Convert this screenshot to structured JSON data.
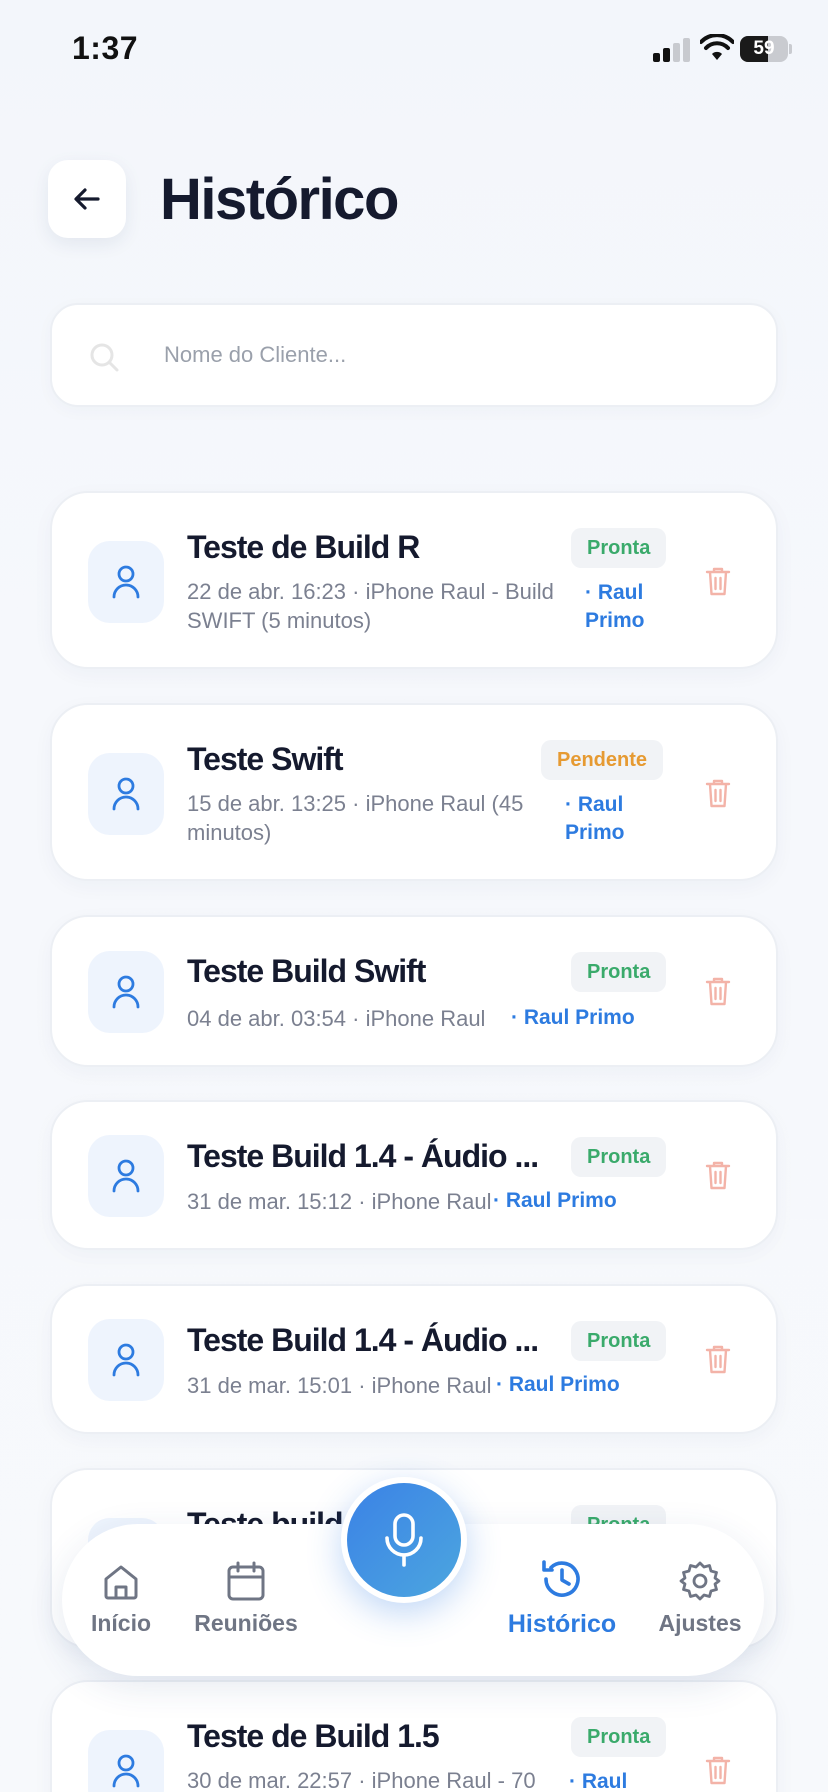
{
  "status_bar": {
    "time": "1:37",
    "battery": "59",
    "battery_level": 0.59
  },
  "header": {
    "title": "Histórico",
    "back_icon": "arrow-left-icon"
  },
  "search": {
    "placeholder": "Nome do Cliente...",
    "value": "",
    "icon": "search-icon"
  },
  "cards": [
    {
      "title": "Teste de Build R",
      "meta": "22 de abr. 16:23 · iPhone Raul - Build SWIFT (5 minutos)",
      "user": "· Raul Primo",
      "status": "Pronta"
    },
    {
      "title": "Teste Swift",
      "meta": "15 de abr. 13:25 · iPhone Raul (45 minutos)",
      "user": "· Raul Primo",
      "status": "Pendente"
    },
    {
      "title": "Teste Build Swift",
      "meta": "04 de abr. 03:54 · iPhone Raul",
      "user": "· Raul Primo",
      "status": "Pronta"
    },
    {
      "title": "Teste Build 1.4 - Áudio ...",
      "meta": "31 de mar. 15:12 · iPhone Raul",
      "user": "· Raul Primo",
      "status": "Pronta"
    },
    {
      "title": "Teste Build 1.4 - Áudio ...",
      "meta": "31 de mar. 15:01 · iPhone Raul",
      "user": "· Raul Primo",
      "status": "Pronta"
    },
    {
      "title": "Teste build",
      "meta": "",
      "user": "",
      "status": "Pronta"
    },
    {
      "title": "Teste de Build 1.5",
      "meta": "30 de mar. 22:57 · iPhone Raul - 70",
      "user": "· Raul",
      "status": "Pronta"
    }
  ],
  "nav": {
    "items": [
      {
        "label": "Início",
        "icon": "home-icon"
      },
      {
        "label": "Reuniões",
        "icon": "calendar-icon"
      },
      {
        "label": "Histórico",
        "icon": "history-icon",
        "active": true
      },
      {
        "label": "Ajustes",
        "icon": "gear-icon"
      }
    ],
    "mic_icon": "microphone-icon"
  },
  "colors": {
    "accent": "#2d7be0",
    "ready": "#3aaa6b",
    "pending": "#e69a32",
    "trash": "#f3b3a8",
    "title": "#151a2e"
  }
}
